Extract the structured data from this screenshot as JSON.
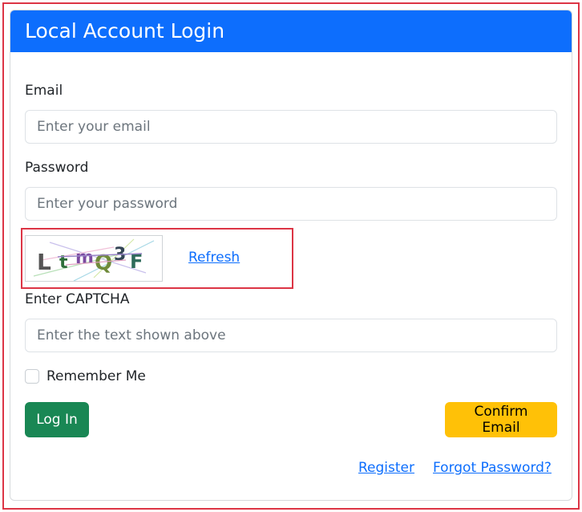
{
  "header": {
    "title": "Local Account Login"
  },
  "email": {
    "label": "Email",
    "placeholder": "Enter your email",
    "value": ""
  },
  "password": {
    "label": "Password",
    "placeholder": "Enter your password",
    "value": ""
  },
  "captcha": {
    "image_text": "LtmQ3F",
    "refresh_label": "Refresh",
    "label": "Enter CAPTCHA",
    "placeholder": "Enter the text shown above",
    "value": ""
  },
  "remember": {
    "label": "Remember Me",
    "checked": false
  },
  "actions": {
    "login_label": "Log In",
    "confirm_label": "Confirm Email"
  },
  "links": {
    "register": "Register",
    "forgot": "Forgot Password?"
  },
  "colors": {
    "primary": "#0d6efd",
    "success": "#198754",
    "warning": "#ffc107",
    "highlight": "#dc3545"
  }
}
